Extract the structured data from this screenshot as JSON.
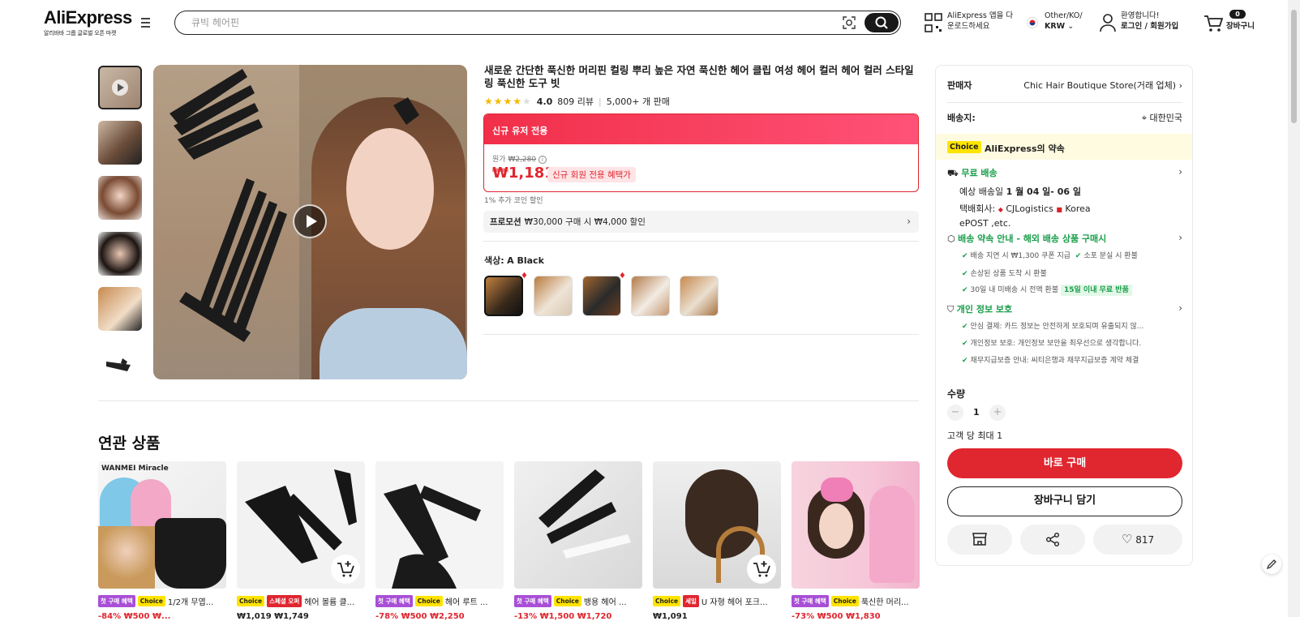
{
  "header": {
    "logo": "AliExpress",
    "tagline": "알리바바 그룹 글로벌 오픈 마켓",
    "search_placeholder": "큐빅 헤어핀",
    "app_line1": "AliExpress 앱을 다",
    "app_line2": "운로드하세요",
    "region_line1": "Other/KO/",
    "region_line2": "KRW",
    "account_line1": "환영합니다!",
    "account_line2": "로그인 / 회원가입",
    "cart_count": "0",
    "cart_label": "장바구니"
  },
  "product": {
    "title": "새로운 간단한 푹신한 머리핀 컬링 뿌리 높은 자연 푹신한 헤어 클립 여성 헤어 컬러 헤어 컬러 스타일링 푹신한 도구 빗",
    "rating": "4.0",
    "rating_fraction": 0.8,
    "reviews": "809 리뷰",
    "sold": "5,000+ 개 판매",
    "promo_header": "신규 유저 전용",
    "original_label": "원가",
    "original_price": "₩2,280",
    "price": "₩1,181",
    "new_member_pill": "신규 회원 전용 혜택가",
    "coin_note": "1% 추가 코인 할인",
    "promo_label": "프로모션",
    "promo_text": "₩30,000 구매 시 ₩4,000 할인",
    "color_label": "색상:",
    "color_value": "A Black"
  },
  "related": {
    "title": "연관 상품",
    "items": [
      {
        "badge1": "첫 구매 혜택",
        "badge2": "Choice",
        "name": "1/2개 무엽...",
        "price": "-84% ₩500 ₩..."
      },
      {
        "badge1": "Choice",
        "badge2": "스페셜 오퍼",
        "name": "헤어 볼륨 클...",
        "price": "₩1,019 ₩1,749"
      },
      {
        "badge1": "첫 구매 혜택",
        "badge2": "Choice",
        "name": "헤어 루트 ...",
        "price": "-78% ₩500 ₩2,250"
      },
      {
        "badge1": "첫 구매 혜택",
        "badge2": "Choice",
        "name": "뱅용 헤어 ...",
        "price": "-13% ₩1,500 ₩1,720"
      },
      {
        "badge1": "Choice",
        "badge2": "세일",
        "name": "U 자형 헤어 포크...",
        "price": "₩1,091"
      },
      {
        "badge1": "첫 구매 혜택",
        "badge2": "Choice",
        "name": "푹신한 머리...",
        "price": "-73% ₩500 ₩1,830"
      }
    ]
  },
  "panel": {
    "seller_label": "판매자",
    "seller_name": "Chic Hair Boutique Store(거래 업체)",
    "ship_to_label": "배송지:",
    "ship_to_value": "대한민국",
    "choice_badge": "Choice",
    "choice_promise": "AliExpress의 약속",
    "free_shipping": "무료 배송",
    "eta_prefix": "예상 배송일",
    "eta": "1 월 04 일- 06 일",
    "carrier_label": "택배회사:",
    "carrier1": "CJLogistics",
    "carrier2": "Korea",
    "carrier3": "ePOST ,etc.",
    "promise_title": "배송 약속 안내 - 해외 배송 상품 구매시",
    "promise1": "배송 지연 시 ₩1,300 쿠폰 지급",
    "promise2": "소포 분실 시 환불",
    "promise3": "손상된 상품 도착 시 환불",
    "promise4": "30일 내 미배송 시 전액 환불",
    "promise4_pill": "15일 이내 무료 반품",
    "privacy_title": "개인 정보 보호",
    "privacy1": "안심 결제: 카드 정보는 안전하게 보호되며 유출되지 않...",
    "privacy2": "개인정보 보호: 개인정보 보안을 최우선으로 생각합니다.",
    "privacy3": "채무지급보증 안내: 씨티은행과 채무지급보증 계약 체결",
    "qty_label": "수량",
    "qty_value": "1",
    "qty_limit": "고객 당 최대 1",
    "buy_now": "바로 구매",
    "add_cart": "장바구니 담기",
    "wish_count": "817"
  }
}
